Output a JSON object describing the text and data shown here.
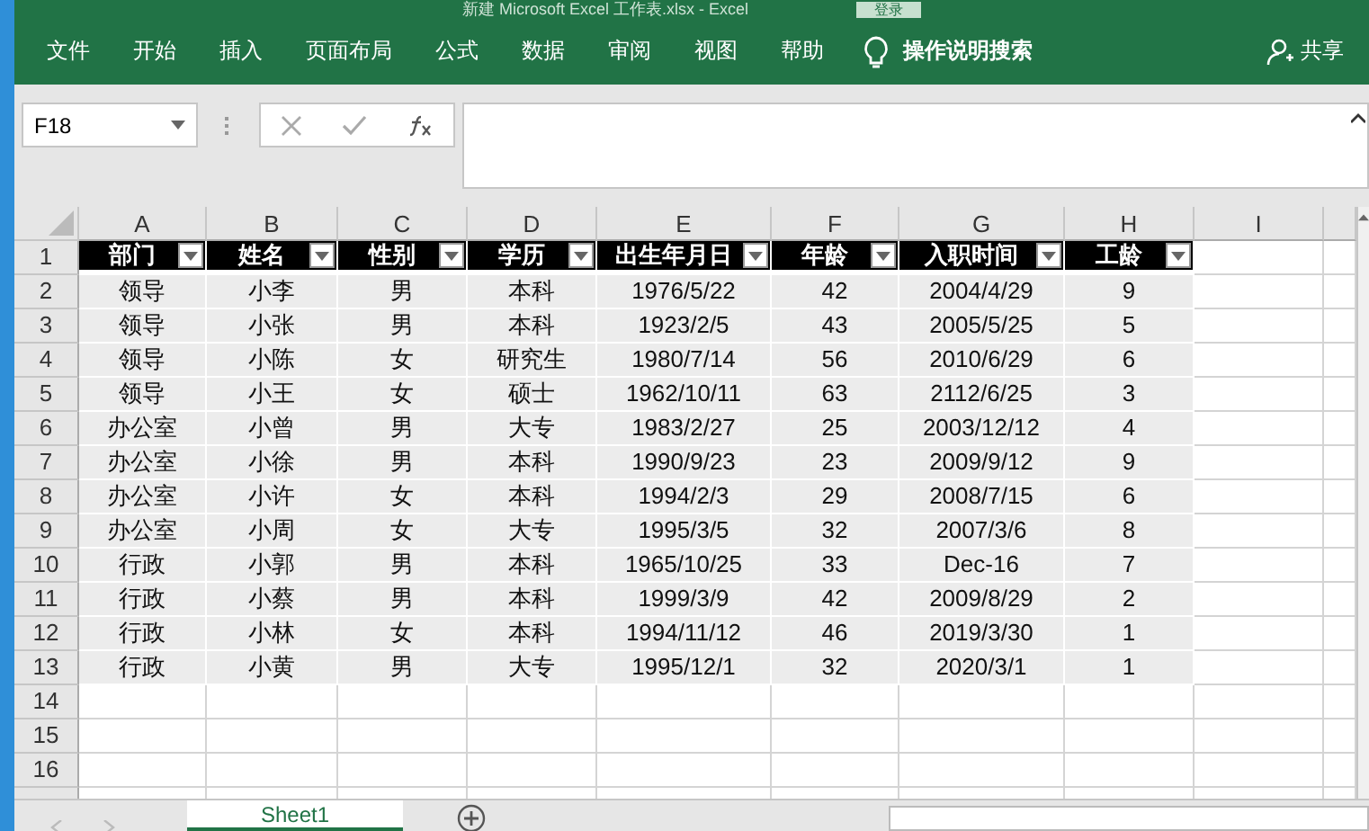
{
  "window": {
    "title": "新建 Microsoft Excel 工作表.xlsx  -  Excel",
    "signin": "登录"
  },
  "ribbon": {
    "tabs": [
      "文件",
      "开始",
      "插入",
      "页面布局",
      "公式",
      "数据",
      "审阅",
      "视图",
      "帮助"
    ],
    "tell_me": "操作说明搜索",
    "share": "共享"
  },
  "formula_bar": {
    "name_box": "F18"
  },
  "columns": [
    "A",
    "B",
    "C",
    "D",
    "E",
    "F",
    "G",
    "H",
    "I"
  ],
  "header_row": {
    "number": "1",
    "cells": [
      "部门",
      "姓名",
      "性别",
      "学历",
      "出生年月日",
      "年龄",
      "入职时间",
      "工龄"
    ]
  },
  "rows": [
    {
      "number": "2",
      "cells": [
        "领导",
        "小李",
        "男",
        "本科",
        "1976/5/22",
        "42",
        "2004/4/29",
        "9"
      ]
    },
    {
      "number": "3",
      "cells": [
        "领导",
        "小张",
        "男",
        "本科",
        "1923/2/5",
        "43",
        "2005/5/25",
        "5"
      ]
    },
    {
      "number": "4",
      "cells": [
        "领导",
        "小陈",
        "女",
        "研究生",
        "1980/7/14",
        "56",
        "2010/6/29",
        "6"
      ]
    },
    {
      "number": "5",
      "cells": [
        "领导",
        "小王",
        "女",
        "硕士",
        "1962/10/11",
        "63",
        "2112/6/25",
        "3"
      ]
    },
    {
      "number": "6",
      "cells": [
        "办公室",
        "小曾",
        "男",
        "大专",
        "1983/2/27",
        "25",
        "2003/12/12",
        "4"
      ]
    },
    {
      "number": "7",
      "cells": [
        "办公室",
        "小徐",
        "男",
        "本科",
        "1990/9/23",
        "23",
        "2009/9/12",
        "9"
      ]
    },
    {
      "number": "8",
      "cells": [
        "办公室",
        "小许",
        "女",
        "本科",
        "1994/2/3",
        "29",
        "2008/7/15",
        "6"
      ]
    },
    {
      "number": "9",
      "cells": [
        "办公室",
        "小周",
        "女",
        "大专",
        "1995/3/5",
        "32",
        "2007/3/6",
        "8"
      ]
    },
    {
      "number": "10",
      "cells": [
        "行政",
        "小郭",
        "男",
        "本科",
        "1965/10/25",
        "33",
        "Dec-16",
        "7"
      ]
    },
    {
      "number": "11",
      "cells": [
        "行政",
        "小蔡",
        "男",
        "本科",
        "1999/3/9",
        "42",
        "2009/8/29",
        "2"
      ]
    },
    {
      "number": "12",
      "cells": [
        "行政",
        "小林",
        "女",
        "本科",
        "1994/11/12",
        "46",
        "2019/3/30",
        "1"
      ]
    },
    {
      "number": "13",
      "cells": [
        "行政",
        "小黄",
        "男",
        "大专",
        "1995/12/1",
        "32",
        "2020/3/1",
        "1"
      ]
    }
  ],
  "empty_rows": [
    "14",
    "15",
    "16"
  ],
  "sheet_tabs": [
    {
      "label": "Sheet1",
      "selected": true
    }
  ]
}
